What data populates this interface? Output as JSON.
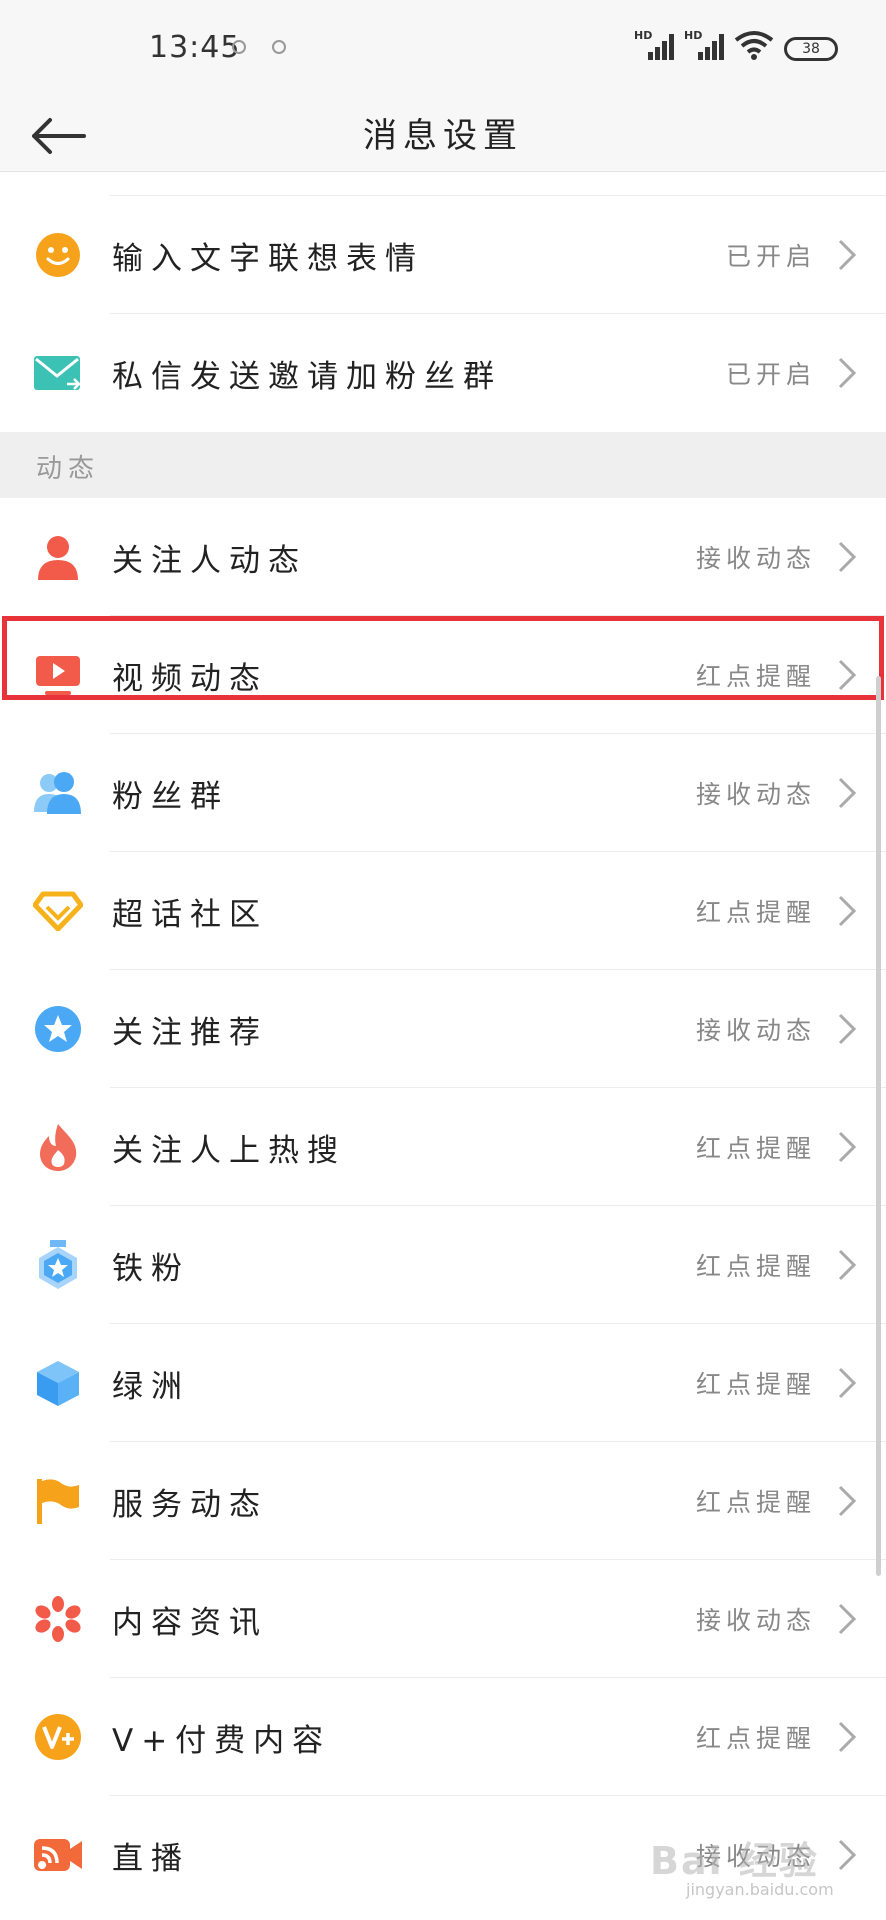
{
  "status": {
    "time": "13:45",
    "battery": "38",
    "signal1": "HD",
    "signal2": "HD"
  },
  "nav": {
    "title": "消息设置"
  },
  "rows_top": [
    {
      "label": "输入文字联想表情",
      "value": "已开启",
      "icon": "smiley-icon"
    },
    {
      "label": "私信发送邀请加粉丝群",
      "value": "已开启",
      "icon": "envelope-icon"
    }
  ],
  "section": {
    "title": "动态"
  },
  "rows": [
    {
      "label": "关注人动态",
      "value": "接收动态",
      "icon": "person-icon"
    },
    {
      "label": "视频动态",
      "value": "红点提醒",
      "icon": "video-icon"
    },
    {
      "label": "粉丝群",
      "value": "接收动态",
      "icon": "group-icon"
    },
    {
      "label": "超话社区",
      "value": "红点提醒",
      "icon": "diamond-icon"
    },
    {
      "label": "关注推荐",
      "value": "接收动态",
      "icon": "star-badge-icon"
    },
    {
      "label": "关注人上热搜",
      "value": "红点提醒",
      "icon": "flame-icon"
    },
    {
      "label": "铁粉",
      "value": "红点提醒",
      "icon": "medal-icon"
    },
    {
      "label": "绿洲",
      "value": "红点提醒",
      "icon": "cube-icon"
    },
    {
      "label": "服务动态",
      "value": "红点提醒",
      "icon": "flag-icon"
    },
    {
      "label": "内容资讯",
      "value": "接收动态",
      "icon": "flower-icon"
    },
    {
      "label": "V+付费内容",
      "value": "红点提醒",
      "icon": "vplus-icon"
    },
    {
      "label": "直播",
      "value": "接收动态",
      "icon": "live-camera-icon"
    }
  ],
  "colors": {
    "highlight": "#e8333a",
    "accent_orange": "#f7a21b",
    "accent_red": "#f25a4a",
    "accent_blue": "#4aa8f5",
    "accent_teal": "#3cc2b5"
  },
  "watermark": {
    "text": "Bai 经验",
    "sub": "jingyan.baidu.com"
  }
}
